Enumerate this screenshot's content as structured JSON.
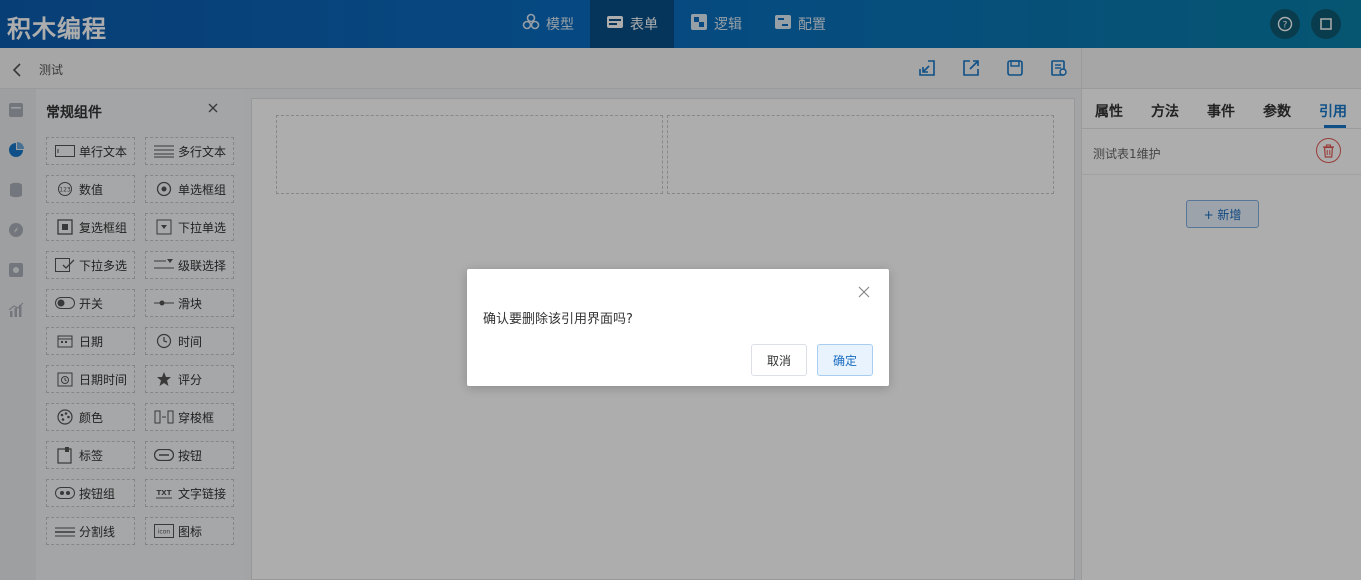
{
  "app": {
    "title": "积木编程"
  },
  "nav": [
    {
      "label": "模型",
      "icon": "model-icon"
    },
    {
      "label": "表单",
      "icon": "form-icon"
    },
    {
      "label": "逻辑",
      "icon": "logic-icon"
    },
    {
      "label": "配置",
      "icon": "config-icon"
    }
  ],
  "nav_active": "表单",
  "subbar": {
    "title": "测试"
  },
  "palette": {
    "title": "常规组件",
    "components": [
      {
        "label": "单行文本",
        "icon": "single-line-text-icon"
      },
      {
        "label": "多行文本",
        "icon": "multi-line-text-icon"
      },
      {
        "label": "数值",
        "icon": "number-icon"
      },
      {
        "label": "单选框组",
        "icon": "radio-group-icon"
      },
      {
        "label": "复选框组",
        "icon": "checkbox-group-icon"
      },
      {
        "label": "下拉单选",
        "icon": "dropdown-single-icon"
      },
      {
        "label": "下拉多选",
        "icon": "dropdown-multi-icon"
      },
      {
        "label": "级联选择",
        "icon": "cascader-icon"
      },
      {
        "label": "开关",
        "icon": "switch-icon"
      },
      {
        "label": "滑块",
        "icon": "slider-icon"
      },
      {
        "label": "日期",
        "icon": "date-icon"
      },
      {
        "label": "时间",
        "icon": "time-icon"
      },
      {
        "label": "日期时间",
        "icon": "datetime-icon"
      },
      {
        "label": "评分",
        "icon": "rating-icon"
      },
      {
        "label": "颜色",
        "icon": "color-icon"
      },
      {
        "label": "穿梭框",
        "icon": "transfer-icon"
      },
      {
        "label": "标签",
        "icon": "tag-icon"
      },
      {
        "label": "按钮",
        "icon": "button-icon"
      },
      {
        "label": "按钮组",
        "icon": "button-group-icon"
      },
      {
        "label": "文字链接",
        "icon": "text-link-icon"
      },
      {
        "label": "分割线",
        "icon": "divider-icon"
      },
      {
        "label": "图标",
        "icon": "icon-component-icon"
      }
    ]
  },
  "right_panel": {
    "tabs": [
      "属性",
      "方法",
      "事件",
      "参数",
      "引用"
    ],
    "active_tab": "引用",
    "reference_item": "测试表1维护",
    "add_label": "+ 新增"
  },
  "dialog": {
    "message": "确认要删除该引用界面吗?",
    "cancel_label": "取消",
    "confirm_label": "确定"
  },
  "colors": {
    "primary": "#1677c8",
    "danger": "#e15a55",
    "topbar": "#0d5cae"
  }
}
